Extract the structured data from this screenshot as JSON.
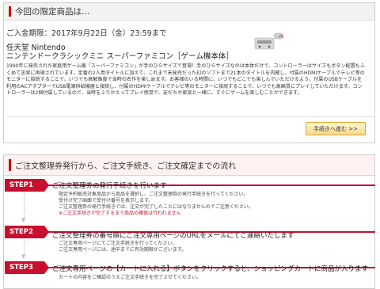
{
  "limited": {
    "header": "今回の限定商品は…",
    "period": "ご入金期限：2017年9月22日（金）23:59まで",
    "brand": "任天堂 Nintendo",
    "product_name": "ニンテンドークラシックミニ スーパーファミコン［ゲーム機本体］",
    "description": "1990年に発売された家庭用ゲーム機「スーパーファミコン」が手のひらサイズで登場！手のひらサイズなのは本体だけで、コントローラーはサイズもボタン配置もふくめて忠実に再現されています。定番の2人用タイトルに加えて、これまで未発売だった幻のソフトまで21本のタイトルを内蔵し、付属のHDMIケーブルでテレビ等のモニターに接続することで、いつでも高解像度で当時の名作を楽しめます。お客様のいる時間に、いつでもどこでも楽しんでいただけるよう、付属のUSBケーブルを利用のACアダプターでUSB電源供給機器と接続し、付属のHDMIケーブルでテレビ等のモニターに接続することで、いつでも高画質にプレイしていただけます。コントローラーは2個付属しているので、当時をふりかえってプレイ感覚で、友だちや家族と一緒に、すぐにゲームを楽しむことができます。",
    "button": "手続きへ進む >>"
  },
  "flow": {
    "header": "ご注文整理券発行から、ご注文手続き、ご注文確定までの流れ",
    "steps": [
      {
        "label": "STEP1",
        "title": "ご注文整理券の発行手続きを行います",
        "lines": [
          "限定予約販売対象商品から商品を選択し、ご注文整理券の発行手続きを行ってください。",
          "受付け完了画面で受付け番号を表示します。",
          "ご注文整理券の発行手続きでは、注文が完了したことにはなりませんのでご注意ください。"
        ],
        "warning": "※ご注文手続きが完了するまで商品の確保は行われません"
      },
      {
        "label": "STEP2",
        "title": "ご注文整理券の番号順にご注文専用ページのURLをメールにてご連絡いたします",
        "lines": [
          "ご注文専用ページにてご注文手続きを行ってください。",
          "ご注文専用ページには、途中までに有効期限がございます。"
        ]
      },
      {
        "label": "STEP3",
        "title": "ご注文専用ページの【カートに入れる】ボタンをクリックすると、ショッピングカートに商品が入ります",
        "lines": [
          "カートの内容をご確認のうえご注文手続きを完了させてください。"
        ]
      }
    ]
  }
}
